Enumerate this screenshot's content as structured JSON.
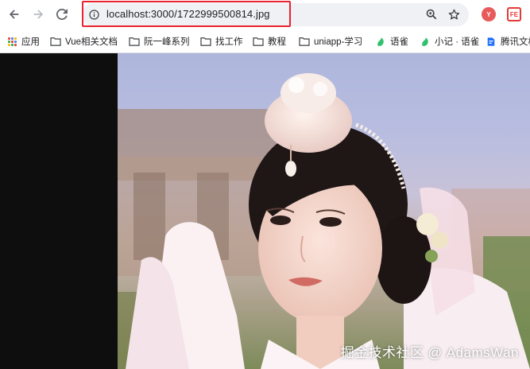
{
  "toolbar": {
    "url": "localhost:3000/1722999500814.jpg",
    "back_icon": "back-arrow-icon",
    "forward_icon": "forward-arrow-icon",
    "reload_icon": "reload-icon",
    "site_info_icon": "info-icon",
    "zoom_icon": "zoom-icon",
    "bookmark_icon": "star-icon",
    "highlight_color": "#e8222e",
    "extensions": [
      {
        "name": "yuque-extension-icon",
        "label": "Y",
        "color": "#e85a5a"
      },
      {
        "name": "fe-helper-extension-icon",
        "label": "FE",
        "color": "#e53935"
      }
    ]
  },
  "bookmarks": [
    {
      "label": "应用",
      "icon": "apps-grid-icon"
    },
    {
      "label": "Vue相关文档",
      "icon": "folder-icon"
    },
    {
      "label": "阮一峰系列",
      "icon": "folder-icon"
    },
    {
      "label": "找工作",
      "icon": "folder-icon"
    },
    {
      "label": "教程",
      "icon": "folder-icon"
    },
    {
      "label": "uniapp-学习",
      "icon": "folder-icon"
    },
    {
      "label": "语雀",
      "icon": "yuque-icon"
    },
    {
      "label": "小记 · 语雀",
      "icon": "yuque-icon"
    },
    {
      "label": "腾讯文档",
      "icon": "tencent-docs-icon"
    }
  ],
  "content": {
    "image_alt": "1722999500814.jpg",
    "watermark": "掘金技术社区 @ AdamsWan"
  }
}
